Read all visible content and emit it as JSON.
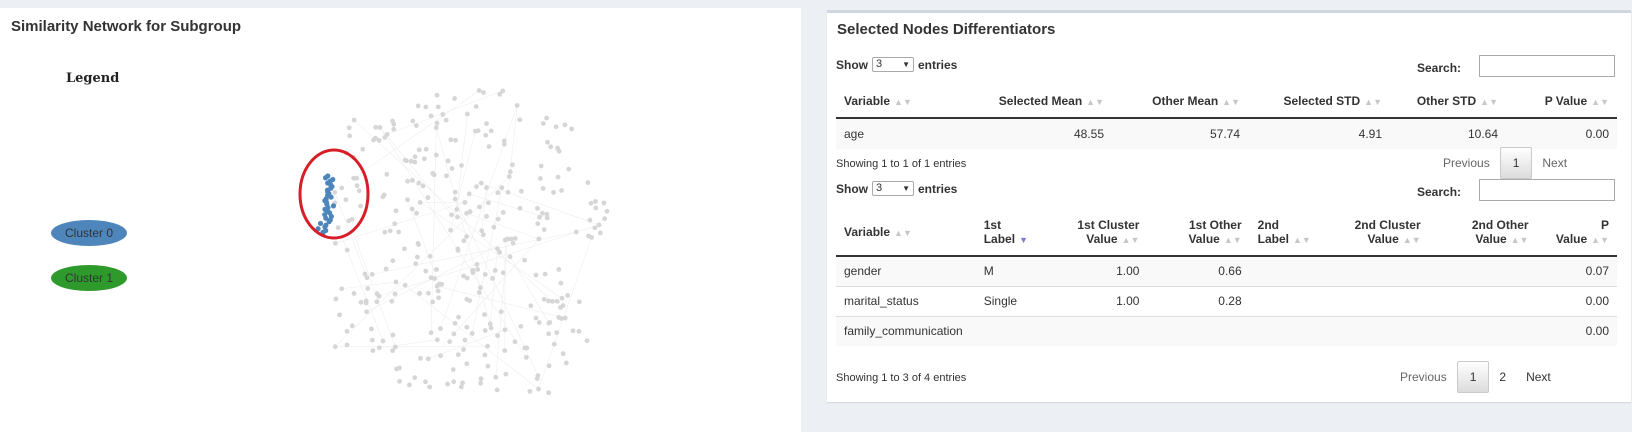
{
  "left": {
    "title": "Similarity Network for Subgroup",
    "legend_title": "Legend",
    "legend": [
      {
        "label": "Cluster 0",
        "color": "#4e86bb"
      },
      {
        "label": "Cluster 1",
        "color": "#2e9a2c"
      }
    ],
    "colors": {
      "node": "#d6d6d6",
      "selected_node": "#4e86bb",
      "highlight_ring": "#d71e27"
    }
  },
  "right": {
    "title": "Selected Nodes Differentiators",
    "table1": {
      "show_label": "Show",
      "entries_value": "3",
      "entries_label": "entries",
      "search_label": "Search:",
      "headers": [
        "Variable",
        "Selected Mean",
        "Other Mean",
        "Selected STD",
        "Other STD",
        "P Value"
      ],
      "rows": [
        [
          "age",
          "48.55",
          "57.74",
          "4.91",
          "10.64",
          "0.00"
        ]
      ],
      "info": "Showing 1 to 1 of 1 entries",
      "pager": {
        "previous": "Previous",
        "pages": [
          "1"
        ],
        "next": "Next"
      }
    },
    "table2": {
      "show_label": "Show",
      "entries_value": "3",
      "entries_label": "entries",
      "search_label": "Search:",
      "headers": [
        {
          "l1": "",
          "l2": "Variable"
        },
        {
          "l1": "1st",
          "l2": "Label"
        },
        {
          "l1": "1st Cluster",
          "l2": "Value"
        },
        {
          "l1": "1st Other",
          "l2": "Value"
        },
        {
          "l1": "2nd",
          "l2": "Label"
        },
        {
          "l1": "2nd Cluster",
          "l2": "Value"
        },
        {
          "l1": "2nd Other",
          "l2": "Value"
        },
        {
          "l1": "P",
          "l2": "Value"
        }
      ],
      "rows": [
        [
          "gender",
          "M",
          "1.00",
          "0.66",
          "",
          "",
          "",
          "0.07"
        ],
        [
          "marital_status",
          "Single",
          "1.00",
          "0.28",
          "",
          "",
          "",
          "0.00"
        ],
        [
          "family_communication",
          "",
          "",
          "",
          "",
          "",
          "",
          "0.00"
        ]
      ],
      "info": "Showing 1 to 3 of 4 entries",
      "pager": {
        "previous": "Previous",
        "pages": [
          "1",
          "2"
        ],
        "next": "Next"
      }
    }
  }
}
